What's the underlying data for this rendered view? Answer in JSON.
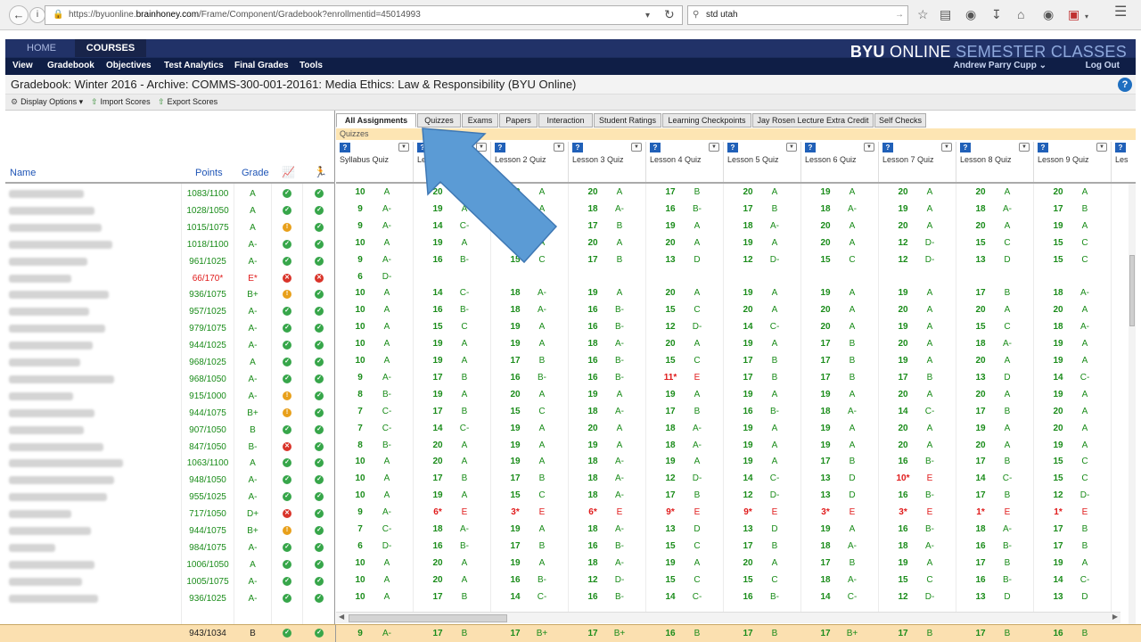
{
  "browser": {
    "url_prefix": "https://byuonline.",
    "url_host": "brainhoney.com",
    "url_path": "/Frame/Component/Gradebook?enrollmentid=45014993",
    "search_value": "std utah"
  },
  "app": {
    "top_tabs": [
      "HOME",
      "COURSES"
    ],
    "brand_bold": "BYU",
    "brand_rest": " ONLINE ",
    "brand_light": "SEMESTER CLASSES",
    "menu": [
      "View",
      "Gradebook",
      "Objectives",
      "Test Analytics",
      "Final Grades",
      "Tools"
    ],
    "user": "Andrew Parry Cupp ⌄",
    "logout": "Log Out",
    "page_title": "Gradebook: Winter 2016 - Archive: COMMS-300-001-20161: Media Ethics: Law & Responsibility (BYU Online)",
    "help": "?"
  },
  "toolbar": {
    "display_options": "Display Options ▾",
    "import_scores": "Import Scores",
    "export_scores": "Export Scores"
  },
  "left_headers": {
    "name": "Name",
    "points": "Points",
    "grade": "Grade"
  },
  "tabs": [
    "All Assignments",
    "Quizzes",
    "Exams",
    "Papers",
    "Interaction",
    "Student Ratings",
    "Learning Checkpoints",
    "Jay Rosen Lecture Extra Credit",
    "Self Checks"
  ],
  "breadcrumb": "Quizzes",
  "columns": [
    "Syllabus Quiz",
    "Lesson 1 Quiz",
    "Lesson 2 Quiz",
    "Lesson 3 Quiz",
    "Lesson 4 Quiz",
    "Lesson 5 Quiz",
    "Lesson 6 Quiz",
    "Lesson 7 Quiz",
    "Lesson 8 Quiz",
    "Lesson 9 Quiz",
    "Les"
  ],
  "colors": {
    "good": "#1a8c1a",
    "bad": "#e01b1b",
    "accent": "#1b2c5c"
  },
  "rows": [
    {
      "points": "1083/1100",
      "grade": "A",
      "s1": "ok",
      "s2": "ok",
      "scores": [
        [
          "10",
          "A"
        ],
        [
          "20",
          "A"
        ],
        [
          "20",
          "A"
        ],
        [
          "20",
          "A"
        ],
        [
          "17",
          "B"
        ],
        [
          "20",
          "A"
        ],
        [
          "19",
          "A"
        ],
        [
          "20",
          "A"
        ],
        [
          "20",
          "A"
        ],
        [
          "20",
          "A"
        ]
      ]
    },
    {
      "points": "1028/1050",
      "grade": "A",
      "s1": "ok",
      "s2": "ok",
      "scores": [
        [
          "9",
          "A-"
        ],
        [
          "19",
          "A"
        ],
        [
          "19",
          "A"
        ],
        [
          "18",
          "A-"
        ],
        [
          "16",
          "B-"
        ],
        [
          "17",
          "B"
        ],
        [
          "18",
          "A-"
        ],
        [
          "19",
          "A"
        ],
        [
          "18",
          "A-"
        ],
        [
          "17",
          "B"
        ]
      ]
    },
    {
      "points": "1015/1075",
      "grade": "A",
      "s1": "warn",
      "s2": "ok",
      "scores": [
        [
          "9",
          "A-"
        ],
        [
          "14",
          "C-"
        ],
        [
          "17",
          "B"
        ],
        [
          "17",
          "B"
        ],
        [
          "19",
          "A"
        ],
        [
          "18",
          "A-"
        ],
        [
          "20",
          "A"
        ],
        [
          "20",
          "A"
        ],
        [
          "20",
          "A"
        ],
        [
          "19",
          "A"
        ]
      ]
    },
    {
      "points": "1018/1100",
      "grade": "A-",
      "s1": "ok",
      "s2": "ok",
      "scores": [
        [
          "10",
          "A"
        ],
        [
          "19",
          "A"
        ],
        [
          "19",
          "A"
        ],
        [
          "20",
          "A"
        ],
        [
          "20",
          "A"
        ],
        [
          "19",
          "A"
        ],
        [
          "20",
          "A"
        ],
        [
          "12",
          "D-"
        ],
        [
          "15",
          "C"
        ],
        [
          "15",
          "C"
        ]
      ]
    },
    {
      "points": "961/1025",
      "grade": "A-",
      "s1": "ok",
      "s2": "ok",
      "scores": [
        [
          "9",
          "A-"
        ],
        [
          "16",
          "B-"
        ],
        [
          "15",
          "C"
        ],
        [
          "17",
          "B"
        ],
        [
          "13",
          "D"
        ],
        [
          "12",
          "D-"
        ],
        [
          "15",
          "C"
        ],
        [
          "12",
          "D-"
        ],
        [
          "13",
          "D"
        ],
        [
          "15",
          "C"
        ]
      ]
    },
    {
      "points": "66/170*",
      "grade": "E*",
      "s1": "bad",
      "s2": "bad",
      "red": true,
      "scores": [
        [
          "6",
          "D-"
        ]
      ]
    },
    {
      "points": "936/1075",
      "grade": "B+",
      "s1": "warn",
      "s2": "ok",
      "scores": [
        [
          "10",
          "A"
        ],
        [
          "14",
          "C-"
        ],
        [
          "18",
          "A-"
        ],
        [
          "19",
          "A"
        ],
        [
          "20",
          "A"
        ],
        [
          "19",
          "A"
        ],
        [
          "19",
          "A"
        ],
        [
          "19",
          "A"
        ],
        [
          "17",
          "B"
        ],
        [
          "18",
          "A-"
        ]
      ]
    },
    {
      "points": "957/1025",
      "grade": "A-",
      "s1": "ok",
      "s2": "ok",
      "scores": [
        [
          "10",
          "A"
        ],
        [
          "16",
          "B-"
        ],
        [
          "18",
          "A-"
        ],
        [
          "16",
          "B-"
        ],
        [
          "15",
          "C"
        ],
        [
          "20",
          "A"
        ],
        [
          "20",
          "A"
        ],
        [
          "20",
          "A"
        ],
        [
          "20",
          "A"
        ],
        [
          "20",
          "A"
        ]
      ]
    },
    {
      "points": "979/1075",
      "grade": "A-",
      "s1": "ok",
      "s2": "ok",
      "scores": [
        [
          "10",
          "A"
        ],
        [
          "15",
          "C"
        ],
        [
          "19",
          "A"
        ],
        [
          "16",
          "B-"
        ],
        [
          "12",
          "D-"
        ],
        [
          "14",
          "C-"
        ],
        [
          "20",
          "A"
        ],
        [
          "19",
          "A"
        ],
        [
          "15",
          "C"
        ],
        [
          "18",
          "A-"
        ]
      ]
    },
    {
      "points": "944/1025",
      "grade": "A-",
      "s1": "ok",
      "s2": "ok",
      "scores": [
        [
          "10",
          "A"
        ],
        [
          "19",
          "A"
        ],
        [
          "19",
          "A"
        ],
        [
          "18",
          "A-"
        ],
        [
          "20",
          "A"
        ],
        [
          "19",
          "A"
        ],
        [
          "17",
          "B"
        ],
        [
          "20",
          "A"
        ],
        [
          "18",
          "A-"
        ],
        [
          "19",
          "A"
        ]
      ]
    },
    {
      "points": "968/1025",
      "grade": "A",
      "s1": "ok",
      "s2": "ok",
      "scores": [
        [
          "10",
          "A"
        ],
        [
          "19",
          "A"
        ],
        [
          "17",
          "B"
        ],
        [
          "16",
          "B-"
        ],
        [
          "15",
          "C"
        ],
        [
          "17",
          "B"
        ],
        [
          "17",
          "B"
        ],
        [
          "19",
          "A"
        ],
        [
          "20",
          "A"
        ],
        [
          "19",
          "A"
        ]
      ]
    },
    {
      "points": "968/1050",
      "grade": "A-",
      "s1": "ok",
      "s2": "ok",
      "scores": [
        [
          "9",
          "A-"
        ],
        [
          "17",
          "B"
        ],
        [
          "16",
          "B-"
        ],
        [
          "16",
          "B-"
        ],
        [
          "11*",
          "E"
        ],
        [
          "17",
          "B"
        ],
        [
          "17",
          "B"
        ],
        [
          "17",
          "B"
        ],
        [
          "13",
          "D"
        ],
        [
          "14",
          "C-"
        ]
      ]
    },
    {
      "points": "915/1000",
      "grade": "A-",
      "s1": "warn",
      "s2": "ok",
      "scores": [
        [
          "8",
          "B-"
        ],
        [
          "19",
          "A"
        ],
        [
          "20",
          "A"
        ],
        [
          "19",
          "A"
        ],
        [
          "19",
          "A"
        ],
        [
          "19",
          "A"
        ],
        [
          "19",
          "A"
        ],
        [
          "20",
          "A"
        ],
        [
          "20",
          "A"
        ],
        [
          "19",
          "A"
        ]
      ]
    },
    {
      "points": "944/1075",
      "grade": "B+",
      "s1": "warn",
      "s2": "ok",
      "scores": [
        [
          "7",
          "C-"
        ],
        [
          "17",
          "B"
        ],
        [
          "15",
          "C"
        ],
        [
          "18",
          "A-"
        ],
        [
          "17",
          "B"
        ],
        [
          "16",
          "B-"
        ],
        [
          "18",
          "A-"
        ],
        [
          "14",
          "C-"
        ],
        [
          "17",
          "B"
        ],
        [
          "20",
          "A"
        ]
      ]
    },
    {
      "points": "907/1050",
      "grade": "B",
      "s1": "ok",
      "s2": "ok",
      "scores": [
        [
          "7",
          "C-"
        ],
        [
          "14",
          "C-"
        ],
        [
          "19",
          "A"
        ],
        [
          "20",
          "A"
        ],
        [
          "18",
          "A-"
        ],
        [
          "19",
          "A"
        ],
        [
          "19",
          "A"
        ],
        [
          "20",
          "A"
        ],
        [
          "19",
          "A"
        ],
        [
          "20",
          "A"
        ]
      ]
    },
    {
      "points": "847/1050",
      "grade": "B-",
      "s1": "bad",
      "s2": "ok",
      "scores": [
        [
          "8",
          "B-"
        ],
        [
          "20",
          "A"
        ],
        [
          "19",
          "A"
        ],
        [
          "19",
          "A"
        ],
        [
          "18",
          "A-"
        ],
        [
          "19",
          "A"
        ],
        [
          "19",
          "A"
        ],
        [
          "20",
          "A"
        ],
        [
          "20",
          "A"
        ],
        [
          "19",
          "A"
        ]
      ]
    },
    {
      "points": "1063/1100",
      "grade": "A",
      "s1": "ok",
      "s2": "ok",
      "scores": [
        [
          "10",
          "A"
        ],
        [
          "20",
          "A"
        ],
        [
          "19",
          "A"
        ],
        [
          "18",
          "A-"
        ],
        [
          "19",
          "A"
        ],
        [
          "19",
          "A"
        ],
        [
          "17",
          "B"
        ],
        [
          "16",
          "B-"
        ],
        [
          "17",
          "B"
        ],
        [
          "15",
          "C"
        ]
      ]
    },
    {
      "points": "948/1050",
      "grade": "A-",
      "s1": "ok",
      "s2": "ok",
      "scores": [
        [
          "10",
          "A"
        ],
        [
          "17",
          "B"
        ],
        [
          "17",
          "B"
        ],
        [
          "18",
          "A-"
        ],
        [
          "12",
          "D-"
        ],
        [
          "14",
          "C-"
        ],
        [
          "13",
          "D"
        ],
        [
          "10*",
          "E"
        ],
        [
          "14",
          "C-"
        ],
        [
          "15",
          "C"
        ]
      ]
    },
    {
      "points": "955/1025",
      "grade": "A-",
      "s1": "ok",
      "s2": "ok",
      "scores": [
        [
          "10",
          "A"
        ],
        [
          "19",
          "A"
        ],
        [
          "15",
          "C"
        ],
        [
          "18",
          "A-"
        ],
        [
          "17",
          "B"
        ],
        [
          "12",
          "D-"
        ],
        [
          "13",
          "D"
        ],
        [
          "16",
          "B-"
        ],
        [
          "17",
          "B"
        ],
        [
          "12",
          "D-"
        ]
      ]
    },
    {
      "points": "717/1050",
      "grade": "D+",
      "s1": "bad",
      "s2": "ok",
      "scores": [
        [
          "9",
          "A-"
        ],
        [
          "6*",
          "E"
        ],
        [
          "3*",
          "E"
        ],
        [
          "6*",
          "E"
        ],
        [
          "9*",
          "E"
        ],
        [
          "9*",
          "E"
        ],
        [
          "3*",
          "E"
        ],
        [
          "3*",
          "E"
        ],
        [
          "1*",
          "E"
        ],
        [
          "1*",
          "E"
        ]
      ]
    },
    {
      "points": "944/1075",
      "grade": "B+",
      "s1": "warn",
      "s2": "ok",
      "scores": [
        [
          "7",
          "C-"
        ],
        [
          "18",
          "A-"
        ],
        [
          "19",
          "A"
        ],
        [
          "18",
          "A-"
        ],
        [
          "13",
          "D"
        ],
        [
          "13",
          "D"
        ],
        [
          "19",
          "A"
        ],
        [
          "16",
          "B-"
        ],
        [
          "18",
          "A-"
        ],
        [
          "17",
          "B"
        ]
      ]
    },
    {
      "points": "984/1075",
      "grade": "A-",
      "s1": "ok",
      "s2": "ok",
      "scores": [
        [
          "6",
          "D-"
        ],
        [
          "16",
          "B-"
        ],
        [
          "17",
          "B"
        ],
        [
          "16",
          "B-"
        ],
        [
          "15",
          "C"
        ],
        [
          "17",
          "B"
        ],
        [
          "18",
          "A-"
        ],
        [
          "18",
          "A-"
        ],
        [
          "16",
          "B-"
        ],
        [
          "17",
          "B"
        ]
      ]
    },
    {
      "points": "1006/1050",
      "grade": "A",
      "s1": "ok",
      "s2": "ok",
      "scores": [
        [
          "10",
          "A"
        ],
        [
          "20",
          "A"
        ],
        [
          "19",
          "A"
        ],
        [
          "18",
          "A-"
        ],
        [
          "19",
          "A"
        ],
        [
          "20",
          "A"
        ],
        [
          "17",
          "B"
        ],
        [
          "19",
          "A"
        ],
        [
          "17",
          "B"
        ],
        [
          "19",
          "A"
        ]
      ]
    },
    {
      "points": "1005/1075",
      "grade": "A-",
      "s1": "ok",
      "s2": "ok",
      "scores": [
        [
          "10",
          "A"
        ],
        [
          "20",
          "A"
        ],
        [
          "16",
          "B-"
        ],
        [
          "12",
          "D-"
        ],
        [
          "15",
          "C"
        ],
        [
          "15",
          "C"
        ],
        [
          "18",
          "A-"
        ],
        [
          "15",
          "C"
        ],
        [
          "16",
          "B-"
        ],
        [
          "14",
          "C-"
        ]
      ]
    },
    {
      "points": "936/1025",
      "grade": "A-",
      "s1": "ok",
      "s2": "ok",
      "scores": [
        [
          "10",
          "A"
        ],
        [
          "17",
          "B"
        ],
        [
          "14",
          "C-"
        ],
        [
          "16",
          "B-"
        ],
        [
          "14",
          "C-"
        ],
        [
          "16",
          "B-"
        ],
        [
          "14",
          "C-"
        ],
        [
          "12",
          "D-"
        ],
        [
          "13",
          "D"
        ],
        [
          "13",
          "D"
        ]
      ]
    }
  ],
  "footer": {
    "points": "943/1034",
    "grade": "B",
    "scores": [
      [
        "9",
        "A-"
      ],
      [
        "17",
        "B"
      ],
      [
        "17",
        "B+"
      ],
      [
        "17",
        "B+"
      ],
      [
        "16",
        "B"
      ],
      [
        "17",
        "B"
      ],
      [
        "17",
        "B+"
      ],
      [
        "17",
        "B"
      ],
      [
        "17",
        "B"
      ],
      [
        "16",
        "B"
      ]
    ]
  }
}
